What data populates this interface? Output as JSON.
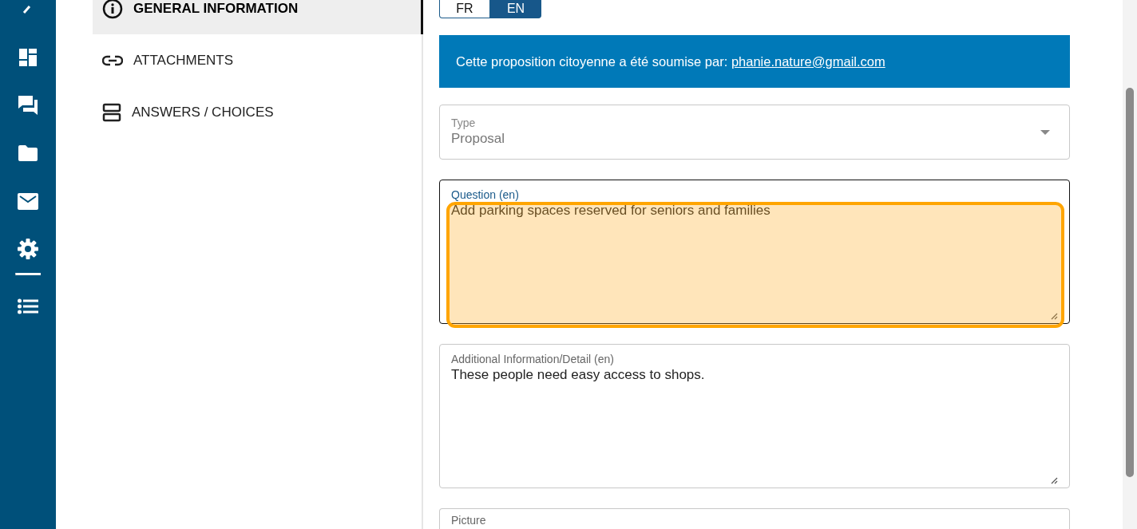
{
  "nav": {
    "items": [
      {
        "kind": "info",
        "label": "GENERAL INFORMATION",
        "selected": true
      },
      {
        "kind": "link",
        "label": "ATTACHMENTS",
        "selected": false
      },
      {
        "kind": "rows",
        "label": "ANSWERS / CHOICES",
        "selected": false
      }
    ]
  },
  "languages": [
    {
      "label": "FR",
      "selected": false
    },
    {
      "label": "EN",
      "selected": true
    }
  ],
  "banner": {
    "text": "Cette proposition citoyenne a été soumise par: ",
    "link": "phanie.nature@gmail.com"
  },
  "fields": [
    {
      "kind": "select",
      "label": "Type",
      "value": "Proposal",
      "disabled": true,
      "focused": false,
      "highlighted": false
    },
    {
      "kind": "textarea",
      "label": "Question (en)",
      "value": "Add parking spaces reserved for seniors and families",
      "disabled": false,
      "focused": true,
      "highlighted": true
    },
    {
      "kind": "textarea",
      "label": "Additional Information/Detail (en)",
      "value": "These people need easy access to shops.",
      "disabled": false,
      "focused": false,
      "highlighted": false
    },
    {
      "kind": "upload",
      "label": "Picture",
      "disabled": false,
      "focused": false,
      "highlighted": false
    }
  ]
}
